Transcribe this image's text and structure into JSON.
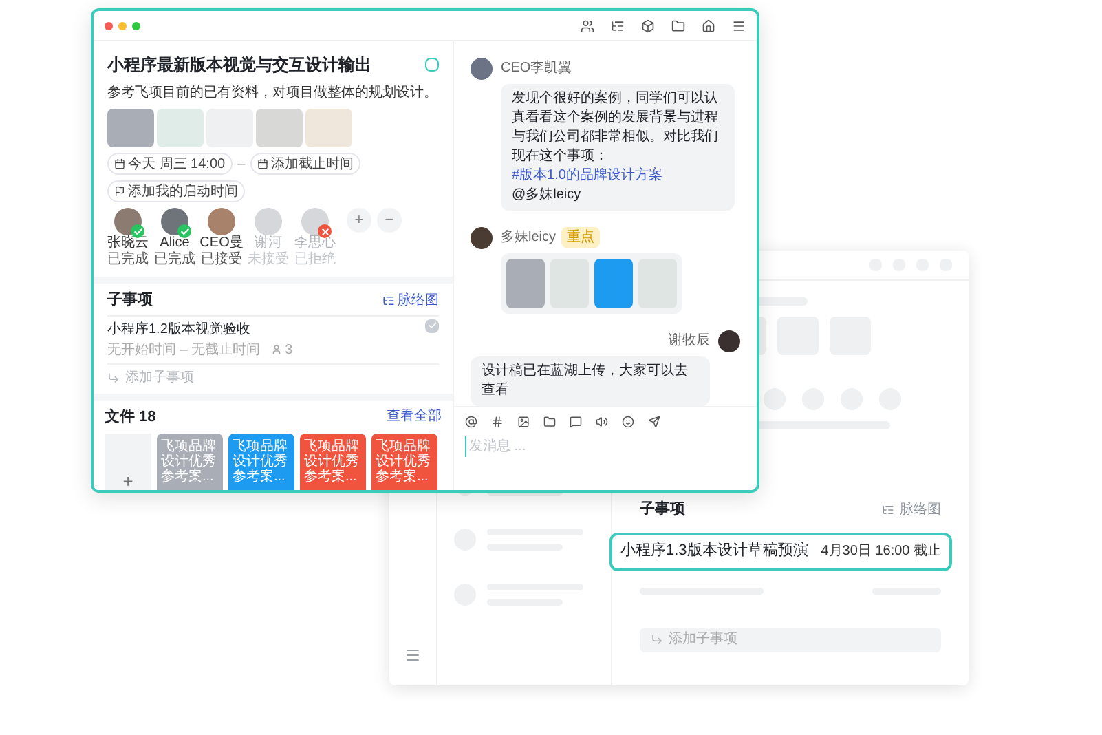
{
  "task": {
    "title": "小程序最新版本视觉与交互设计输出",
    "checked": false,
    "description": "参考飞项目前的已有资料，对项目做整体的规划设计。",
    "start_time": "今天 周三 14:00",
    "separator": "–",
    "deadline": "添加截止时间",
    "reminder": "添加我的启动时间",
    "members": [
      {
        "name": "张晓云",
        "status": "已完成",
        "kind": "done"
      },
      {
        "name": "Alice",
        "status": "已完成",
        "kind": "done"
      },
      {
        "name": "CEO曼",
        "status": "已接受",
        "kind": "accepted"
      },
      {
        "name": "谢河",
        "status": "未接受",
        "kind": "pending"
      },
      {
        "name": "李思心",
        "status": "已拒绝",
        "kind": "declined"
      }
    ],
    "add_member": "+",
    "remove_member": "−"
  },
  "subtasks": {
    "title": "子事项",
    "action": "脉络图",
    "items": [
      {
        "title": "小程序1.2版本视觉验收",
        "meta": "无开始时间 – 无截止时间",
        "count": "3",
        "checked": true
      }
    ],
    "add": "添加子事项"
  },
  "files": {
    "title": "文件 18",
    "action": "查看全部",
    "add": "+",
    "items": [
      {
        "label": "飞项品牌设计优秀参考案...",
        "color": "#a9adb6"
      },
      {
        "label": "飞项品牌设计优秀参考案...",
        "color": "#1d9bf0"
      },
      {
        "label": "飞项品牌设计优秀参考案...",
        "color": "#f0533e"
      },
      {
        "label": "飞项品牌设计优秀参考案...",
        "color": "#f0533e"
      }
    ]
  },
  "chat": {
    "messages": [
      {
        "sender": "CEO李凯翼",
        "kind": "received",
        "text": "发现个很好的案例，同学们可以认真看看这个案例的发展背景与进程与我们公司都非常相似。对比我们现在这个事项：",
        "link": "#版本1.0的品牌设计方案",
        "mention": "@多妹leicy"
      },
      {
        "sender": "多妹leicy",
        "kind": "attachments",
        "tag": "重点",
        "attachments": [
          {
            "kind": "file",
            "color": "#a9adb6"
          },
          {
            "kind": "photo"
          },
          {
            "kind": "file",
            "color": "#1d9bf0"
          },
          {
            "kind": "photo"
          }
        ]
      },
      {
        "sender": "谢牧辰",
        "kind": "sent",
        "text": "设计稿已在蓝湖上传，大家可以去查看"
      }
    ],
    "composer_placeholder": "发消息 ..."
  },
  "back_window": {
    "subtasks": {
      "title": "子事项",
      "action": "脉络图",
      "items": [
        {
          "title": "小程序1.3版本设计草稿预演",
          "due": "4月30日 16:00 截止",
          "selected": true
        }
      ],
      "add": "添加子事项"
    }
  }
}
